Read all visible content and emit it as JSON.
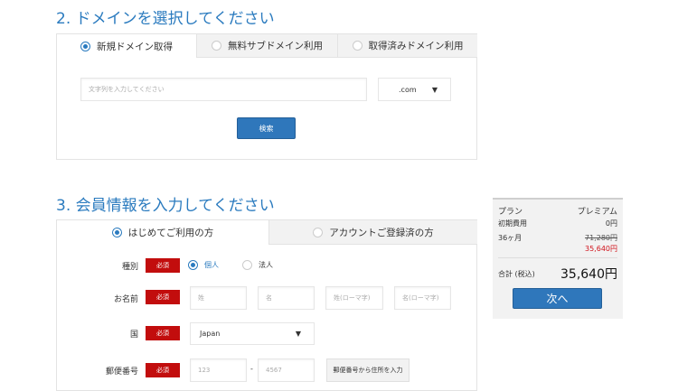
{
  "domain_section": {
    "title": "2. ドメインを選択してください",
    "tabs": [
      {
        "label": "新規ドメイン取得",
        "selected": true
      },
      {
        "label": "無料サブドメイン利用",
        "selected": false
      },
      {
        "label": "取得済みドメイン利用",
        "selected": false
      }
    ],
    "search_placeholder": "文字列を入力してください",
    "tld_value": ".com",
    "search_button": "検索"
  },
  "member_section": {
    "title": "3. 会員情報を入力してください",
    "tabs": [
      {
        "label": "はじめてご利用の方",
        "selected": true
      },
      {
        "label": "アカウントご登録済の方",
        "selected": false
      }
    ],
    "required_label": "必須",
    "type": {
      "label": "種別",
      "options": [
        {
          "label": "個人",
          "selected": true
        },
        {
          "label": "法人",
          "selected": false
        }
      ]
    },
    "name": {
      "label": "お名前",
      "placeholders": [
        "姓",
        "名",
        "姓(ローマ字)",
        "名(ローマ字)"
      ]
    },
    "country": {
      "label": "国",
      "value": "Japan"
    },
    "postal": {
      "label": "郵便番号",
      "placeholders": [
        "123",
        "4567"
      ],
      "separator": "-",
      "lookup_button": "郵便番号から住所を入力"
    }
  },
  "summary": {
    "plan_label": "プラン",
    "plan_value": "プレミアム",
    "initial_label": "初期費用",
    "initial_value": "0円",
    "term_label": "36ヶ月",
    "original_price": "71,280円",
    "discount_price": "35,640円",
    "total_label": "合計 (税込)",
    "total_value": "35,640円",
    "next_button": "次へ"
  },
  "icons": {
    "dropdown": "triangle-down-icon"
  },
  "colors": {
    "accent": "#2b7bbf",
    "required": "#c20d0d",
    "discount": "#d0121b"
  }
}
